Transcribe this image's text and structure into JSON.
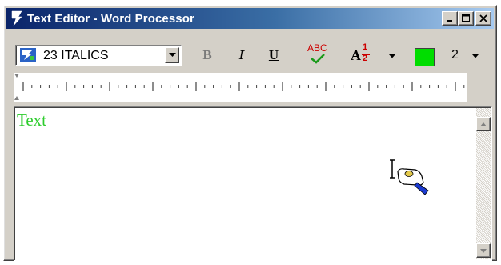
{
  "window": {
    "title": "Text Editor - Word Processor"
  },
  "toolbar": {
    "font_value": "23 ITALICS",
    "bold_label": "B",
    "italic_label": "I",
    "underline_label": "U",
    "spell_label": "ABC",
    "fraction_letter": "A",
    "fraction_numerator": "1",
    "fraction_denominator": "2",
    "color_hex": "#00dd00",
    "line_weight": "2"
  },
  "editor": {
    "text": "Text",
    "text_color": "#2ecc2e"
  },
  "icons": {
    "app": "app-logo-icon",
    "minimize": "minimize-icon",
    "maximize": "maximize-icon",
    "close": "close-icon",
    "font": "font-icon",
    "spell_check": "spell-check-icon",
    "cursor": "text-cursor-hand-icon",
    "scroll_up": "arrow-up-icon",
    "scroll_down": "arrow-down-icon"
  }
}
